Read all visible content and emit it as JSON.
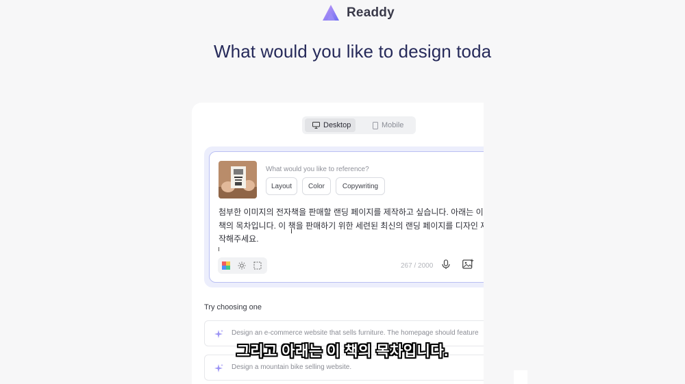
{
  "brand": {
    "name": "Readdy"
  },
  "hero": {
    "title": "What would you like to design toda"
  },
  "device_toggle": {
    "desktop_label": "Desktop",
    "mobile_label": "Mobile",
    "selected": "Desktop"
  },
  "prompt": {
    "reference_question": "What would you like to reference?",
    "chips": [
      "Layout",
      "Color",
      "Copywriting"
    ],
    "lines": [
      "첨부한 이미지의 전자책을 판매할 랜딩 페이지를 제작하고 싶습니다. 아래는 이",
      "책의 목차입니다. 이 책을 판매하기 위한 세련된 최신의 랜딩 페이지를 디자인 제",
      "작해주세요."
    ],
    "char_count": "267 / 2000"
  },
  "suggestions": {
    "label": "Try choosing one",
    "items": [
      "Design an e-commerce website that sells furniture. The homepage should feature",
      "Design a mountain bike selling website."
    ]
  },
  "caption": "그리고 아래는 이 책의 목차입니다.",
  "colors": {
    "accent": "#b9bff3",
    "title": "#262a5a",
    "background": "#f7f7f8"
  },
  "icons": [
    "logo-icon",
    "monitor-icon",
    "phone-icon",
    "palette-icon",
    "sun-icon",
    "crop-icon",
    "mic-icon",
    "image-icon",
    "sparkle-icon"
  ]
}
